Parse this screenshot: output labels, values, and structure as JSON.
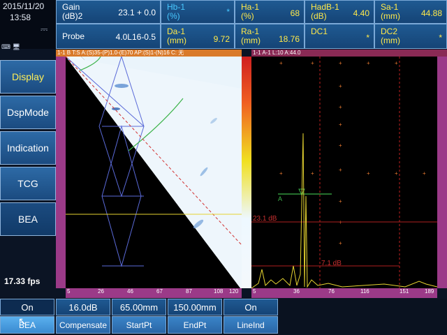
{
  "status": {
    "date": "2015/11/20",
    "time": "13:58",
    "fps": "17.33 fps"
  },
  "params": {
    "gain_label": "Gain (dB)2",
    "gain_value": "23.1 + 0.0",
    "probe_label": "Probe",
    "probe_value": "4.0L16-0.5",
    "hb_label": "Hb-1 (%)",
    "hb_value": "*",
    "da_label": "Da-1 (mm)",
    "da_value": "9.72",
    "ha_label": "Ha-1 (%)",
    "ha_value": "68",
    "ra_label": "Ra-1 (mm)",
    "ra_value": "18.76",
    "hadb_label": "HadB-1 (dB)",
    "hadb_value": "4.40",
    "dc1_label": "DC1",
    "dc1_value": "*",
    "sa_label": "Sa-1 (mm)",
    "sa_value": "44.88",
    "dc2_label": "DC2 (mm)",
    "dc2_value": "*"
  },
  "menu": {
    "items": [
      "Display",
      "DspMode",
      "Indication",
      "TCG",
      "BEA"
    ]
  },
  "views": {
    "left_title": "1-1 B  T:S A:(S)35-(P)1.0-(E)70 AP:(S)1-(N)16 C: 无",
    "right_title": "1-1 A-1  L:10  A:44.0",
    "left_ticks_x": [
      "5",
      "26",
      "46",
      "67",
      "87",
      "108",
      "120"
    ],
    "right_ticks_x": [
      "5",
      "36",
      "76",
      "116",
      "151",
      "189"
    ],
    "marker_a": "A",
    "gate1": "23.1 dB",
    "gate2": "7.1 dB"
  },
  "softkeys": [
    {
      "value": "On",
      "label": "BEA"
    },
    {
      "value": "16.0dB",
      "label": "Compensate"
    },
    {
      "value": "65.00mm",
      "label": "StartPt"
    },
    {
      "value": "150.00mm",
      "label": "EndPt"
    },
    {
      "value": "On",
      "label": "LineInd"
    }
  ]
}
